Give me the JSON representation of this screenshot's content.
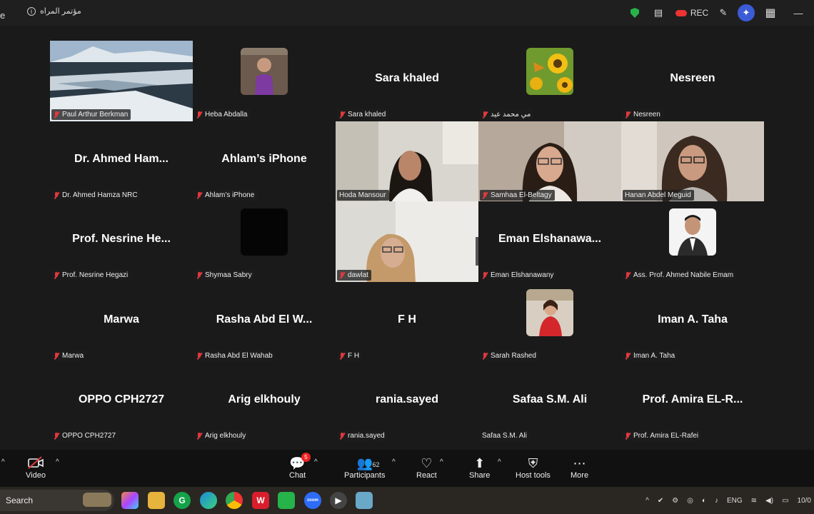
{
  "titlebar": {
    "edge_char": "e",
    "meeting_name": "مؤتمر المراه",
    "info_icon": "info-icon",
    "security_icon": "shield-icon",
    "notes_icon": "notes-icon",
    "rec_label": "REC",
    "edit_icon": "pencil-icon",
    "ai_icon": "sparkle-icon",
    "apps_icon": "grid-icon",
    "minimize_icon": "minimize-icon"
  },
  "tiles": [
    {
      "big": "",
      "name": "Paul Arthur Berkman",
      "kind": "landscape"
    },
    {
      "big": "",
      "name": "Heba Abdalla",
      "kind": "avatar-purple"
    },
    {
      "big": "Sara khaled",
      "name": "Sara khaled",
      "kind": "text"
    },
    {
      "big": "",
      "name": "مي محمد عيد",
      "kind": "avatar-sunflower"
    },
    {
      "big": "Nesreen",
      "name": "Nesreen",
      "kind": "text"
    },
    {
      "big": "Dr. Ahmed Ham...",
      "name": "Dr. Ahmed Hamza NRC",
      "kind": "text"
    },
    {
      "big": "Ahlam’s iPhone",
      "name": "Ahlam’s iPhone",
      "kind": "text"
    },
    {
      "big": "",
      "name": "Hoda Mansour",
      "kind": "video-hoda"
    },
    {
      "big": "",
      "name": "Samhaa El-Beltagy",
      "kind": "video-samhaa"
    },
    {
      "big": "",
      "name": "Hanan Abdel Meguid",
      "kind": "video-hanan"
    },
    {
      "big": "Prof. Nesrine He...",
      "name": "Prof. Nesrine Hegazi",
      "kind": "text"
    },
    {
      "big": "",
      "name": "Shymaa Sabry",
      "kind": "avatar-black"
    },
    {
      "big": "",
      "name": "dawlat",
      "kind": "video-dawlat"
    },
    {
      "big": "Eman Elshanawa...",
      "name": "Eman Elshanawany",
      "kind": "text"
    },
    {
      "big": "",
      "name": "Ass. Prof. Ahmed Nabile Emam",
      "kind": "avatar-man"
    },
    {
      "big": "Marwa",
      "name": "Marwa",
      "kind": "text"
    },
    {
      "big": "Rasha Abd El W...",
      "name": "Rasha Abd El Wahab",
      "kind": "text"
    },
    {
      "big": "F H",
      "name": "F H",
      "kind": "text"
    },
    {
      "big": "",
      "name": "Sarah Rashed",
      "kind": "avatar-sarah"
    },
    {
      "big": "Iman A. Taha",
      "name": "Iman A. Taha",
      "kind": "text"
    },
    {
      "big": "OPPO CPH2727",
      "name": "OPPO CPH2727",
      "kind": "text"
    },
    {
      "big": "Arig elkhouly",
      "name": "Arig elkhouly",
      "kind": "text"
    },
    {
      "big": "rania.sayed",
      "name": "rania.sayed",
      "kind": "text"
    },
    {
      "big": "Safaa S.M. Ali",
      "name": "Safaa S.M. Ali",
      "kind": "text-nomic"
    },
    {
      "big": "Prof. Amira EL-R...",
      "name": "Prof. Amira EL-Rafei",
      "kind": "text"
    }
  ],
  "controls": {
    "video_label": "Video",
    "chat_label": "Chat",
    "chat_badge": "5",
    "participants_label": "Participants",
    "participants_count": "62",
    "react_label": "React",
    "share_label": "Share",
    "host_tools_label": "Host tools",
    "more_label": "More"
  },
  "taskbar": {
    "search_label": "Search",
    "lang": "ENG",
    "date_partial": "10/0"
  }
}
